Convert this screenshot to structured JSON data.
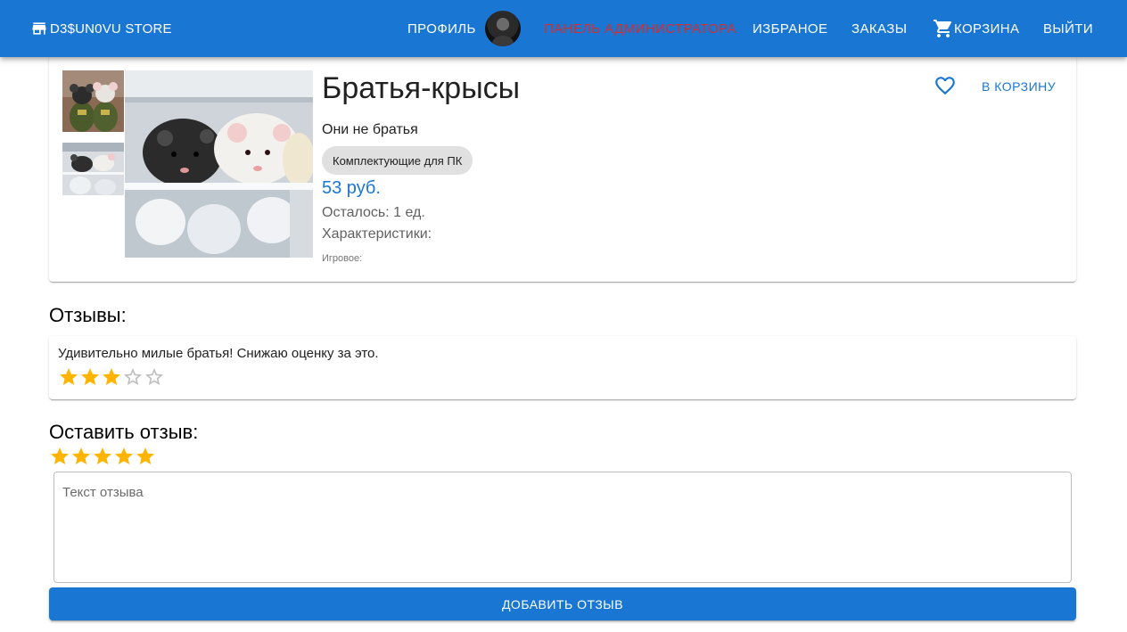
{
  "colors": {
    "primary": "#1976d2",
    "admin_link": "#d32f2f",
    "star_filled": "#ffb400",
    "star_empty": "#bdbdbd"
  },
  "header": {
    "brand_icon": "store-icon",
    "brand": "D3$UN0VU STORE",
    "profile_label": "ПРОФИЛЬ",
    "admin_label": "ПАНЕЛЬ АДМИНИСТРАТОРА",
    "favorites_label": "ИЗБРАНОЕ",
    "orders_label": "ЗАКАЗЫ",
    "cart_icon": "cart-icon",
    "cart_label": "КОРЗИНА",
    "logout_label": "ВЫЙТИ"
  },
  "product": {
    "title": "Братья-крысы",
    "description": "Они не братья",
    "category": "Комплектующие для ПК",
    "price": "53 руб.",
    "stock": "Осталось: 1 ед.",
    "specs_heading": "Характеристики:",
    "spec_row": "Игровое:",
    "favorite_icon": "heart-outline-icon",
    "add_to_cart_label": "В КОРЗИНУ",
    "images": [
      "thumb-rats-in-uniform",
      "thumb-rats-in-fridge",
      "main-rats-in-fridge"
    ]
  },
  "reviews": {
    "heading": "Отзывы:",
    "items": [
      {
        "text": "Удивительно милые братья! Снижаю оценку за это.",
        "rating": 3,
        "max": 5
      }
    ]
  },
  "new_review": {
    "heading": "Оставить отзыв:",
    "rating": 5,
    "max": 5,
    "placeholder": "Текст отзыва",
    "value": "",
    "submit_label": "ДОБАВИТЬ ОТЗЫВ"
  }
}
